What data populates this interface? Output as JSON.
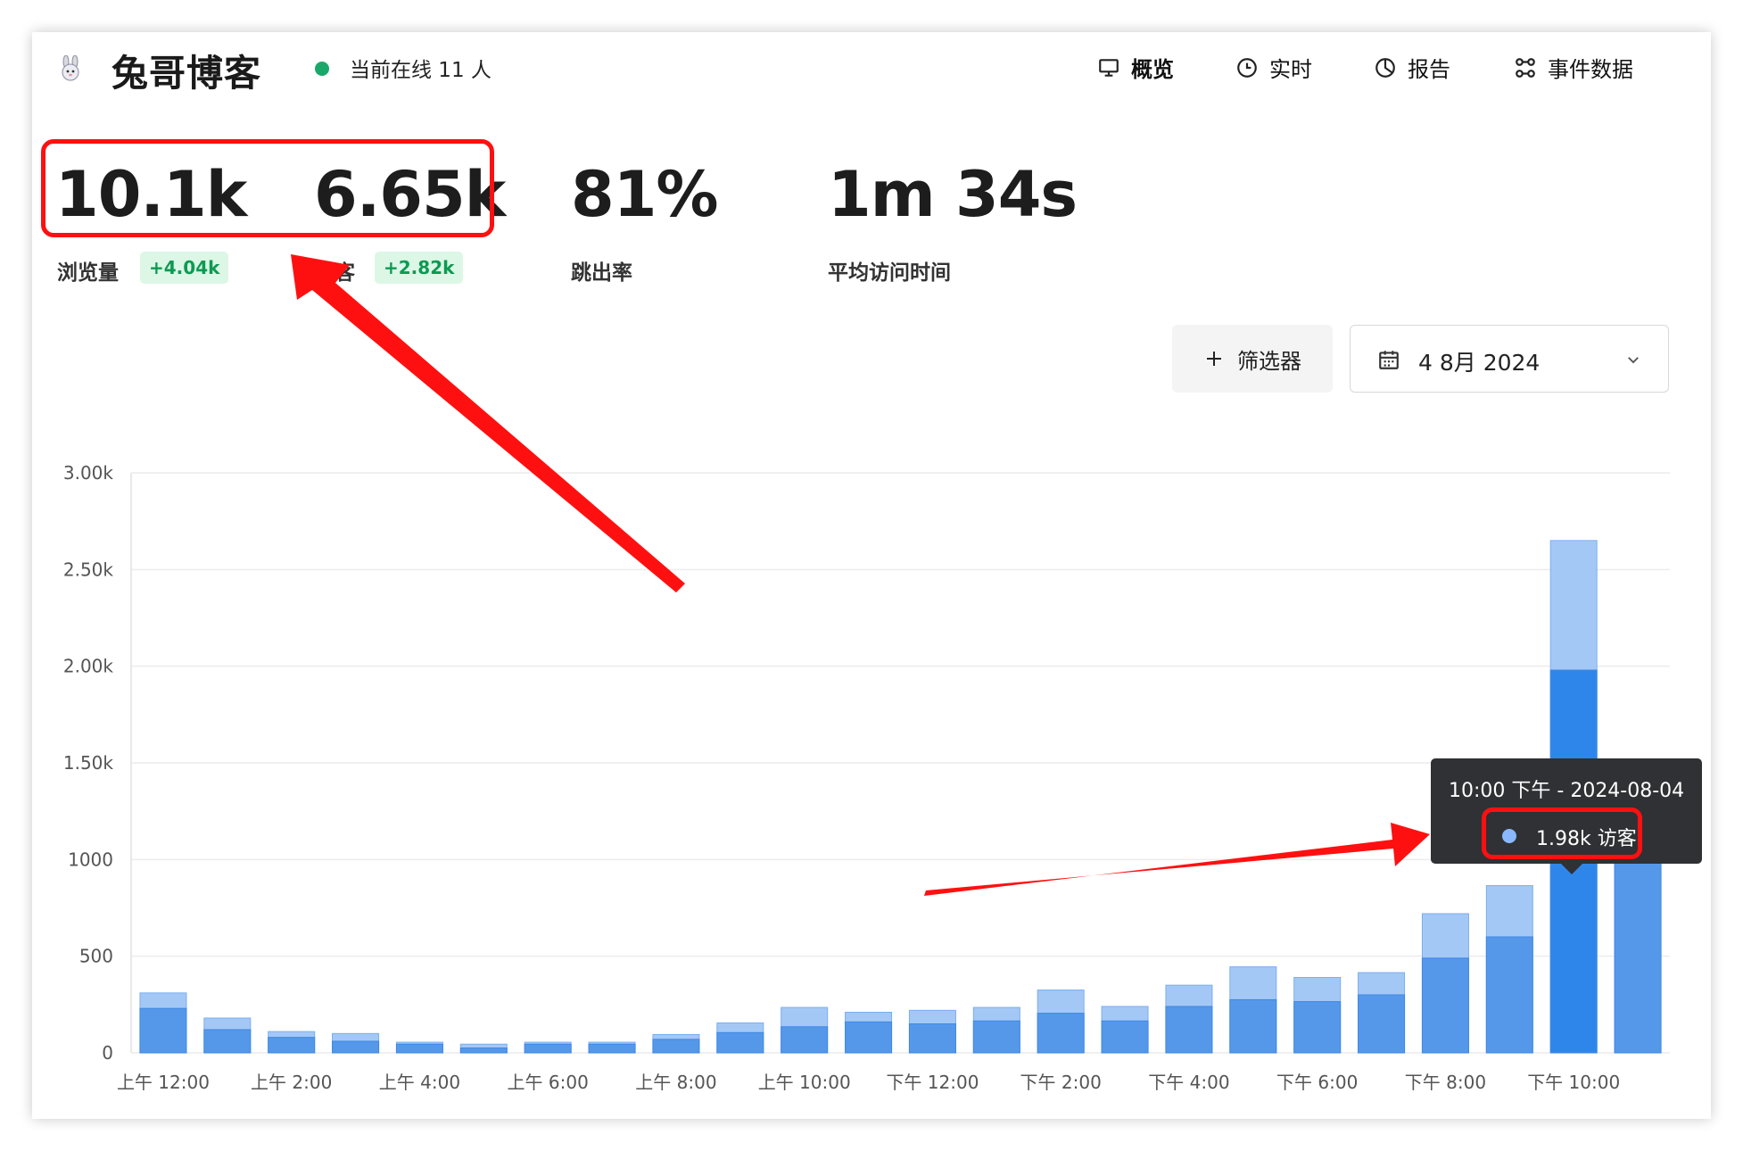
{
  "header": {
    "site_title": "兔哥博客",
    "online_text": "当前在线 11 人",
    "nav": [
      {
        "label": "概览",
        "icon": "monitor-icon"
      },
      {
        "label": "实时",
        "icon": "clock-icon"
      },
      {
        "label": "报告",
        "icon": "pie-chart-icon"
      },
      {
        "label": "事件数据",
        "icon": "nodes-icon"
      }
    ]
  },
  "metrics": {
    "pageviews": {
      "value": "10.1k",
      "label": "浏览量",
      "change": "+4.04k"
    },
    "visitors": {
      "value": "6.65k",
      "label": "访客",
      "change": "+2.82k"
    },
    "bounce_rate": {
      "value": "81%",
      "label": "跳出率"
    },
    "avg_visit_time": {
      "value": "1m 34s",
      "label": "平均访问时间"
    }
  },
  "controls": {
    "filter_label": "筛选器",
    "date_label": "4 8月 2024"
  },
  "tooltip": {
    "title": "10:00 下午 - 2024-08-04",
    "value": "1.98k 访客"
  },
  "colors": {
    "pageviews_bar": "#a4c8f5",
    "visitors_bar": "#5598ea",
    "visitors_bar_active": "#2f86ea",
    "online_dot": "#1aa86a",
    "badge_bg": "#dcf7e6",
    "badge_text": "#0d9a52",
    "annotation": "#ff1010"
  },
  "chart_data": {
    "type": "bar",
    "stacked": "overlay",
    "x_tick_labels": [
      "上午 12:00",
      "上午 2:00",
      "上午 4:00",
      "上午 6:00",
      "上午 8:00",
      "上午 10:00",
      "下午 12:00",
      "下午 2:00",
      "下午 4:00",
      "下午 6:00",
      "下午 8:00",
      "下午 10:00"
    ],
    "y_tick_labels": [
      "0",
      "500",
      "1000",
      "1.50k",
      "2.00k",
      "2.50k",
      "3.00k"
    ],
    "ylim": [
      0,
      3000
    ],
    "grid": true,
    "hours": 24,
    "series": [
      {
        "name": "浏览量",
        "values": [
          310,
          180,
          110,
          100,
          55,
          45,
          55,
          55,
          95,
          155,
          235,
          210,
          220,
          235,
          325,
          240,
          350,
          445,
          390,
          415,
          720,
          865,
          2650,
          1380
        ]
      },
      {
        "name": "访客",
        "values": [
          230,
          120,
          80,
          60,
          45,
          25,
          45,
          45,
          70,
          105,
          135,
          160,
          150,
          165,
          205,
          165,
          240,
          275,
          265,
          300,
          490,
          600,
          1980,
          1000
        ]
      }
    ],
    "active_index": 22
  }
}
